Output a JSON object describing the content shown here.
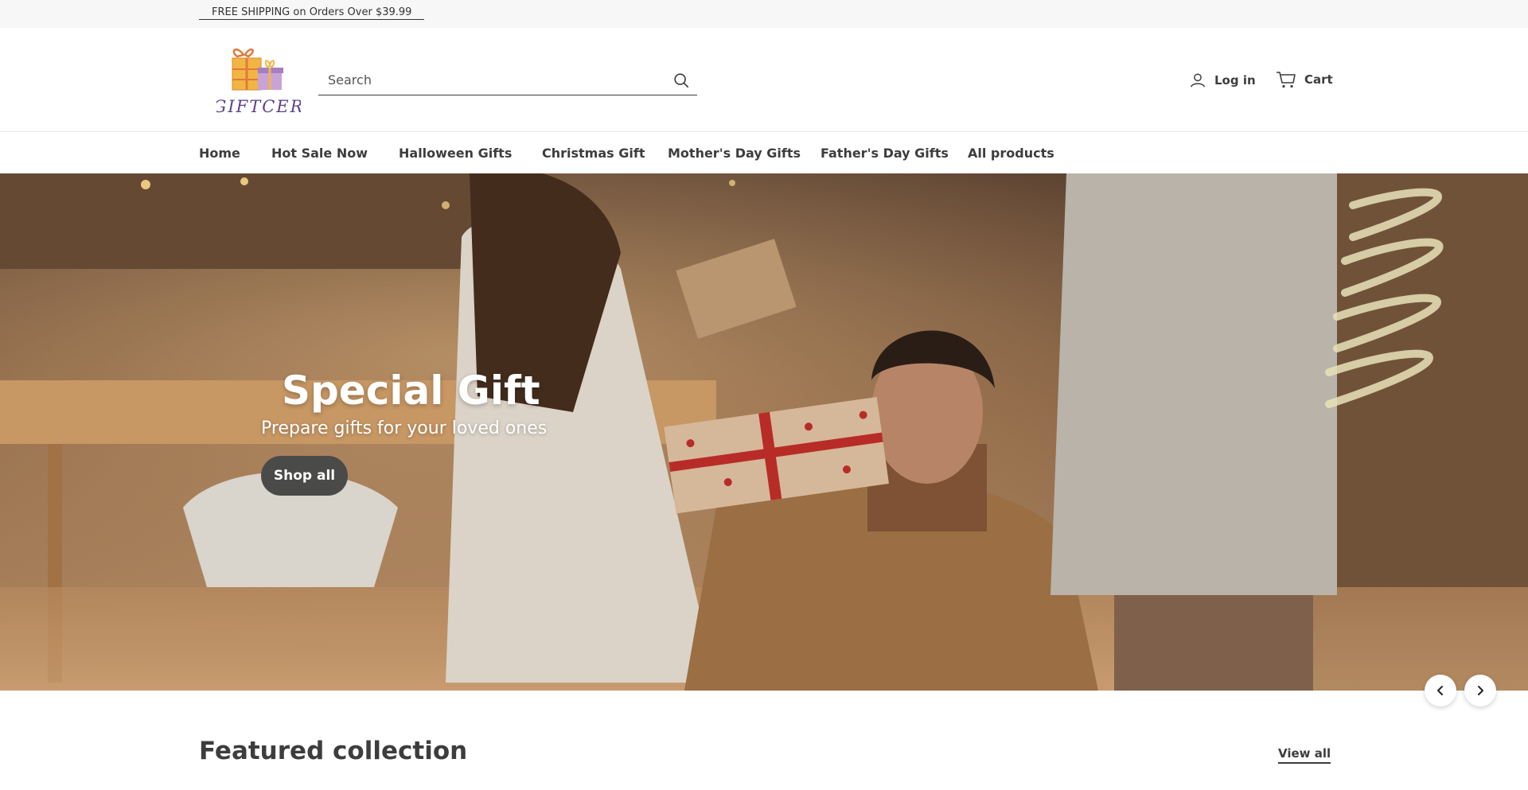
{
  "announcement": {
    "text": "FREE SHIPPING on Orders Over $39.99"
  },
  "header": {
    "logo_text": "GIFTCER",
    "search": {
      "placeholder": "Search",
      "value": ""
    },
    "account_label": "Log in",
    "cart_label": "Cart"
  },
  "nav": {
    "items": [
      {
        "label": "Home"
      },
      {
        "label": "Hot Sale Now"
      },
      {
        "label": "Halloween Gifts"
      },
      {
        "label": "Christmas Gift"
      },
      {
        "label": "Mother's Day Gifts"
      },
      {
        "label": "Father's Day Gifts"
      },
      {
        "label": "All products"
      }
    ]
  },
  "hero": {
    "title": "Special Gift",
    "subtitle": "Prepare gifts for your loved ones",
    "button_label": "Shop all"
  },
  "featured": {
    "title": "Featured collection",
    "view_all_label": "View all"
  },
  "colors": {
    "text": "#3d3d3d",
    "announcement_bg": "#f7f7f7",
    "button_dark": "#4a4a48",
    "logo_purple": "#5b3f8c",
    "logo_orange": "#e8a23a"
  }
}
